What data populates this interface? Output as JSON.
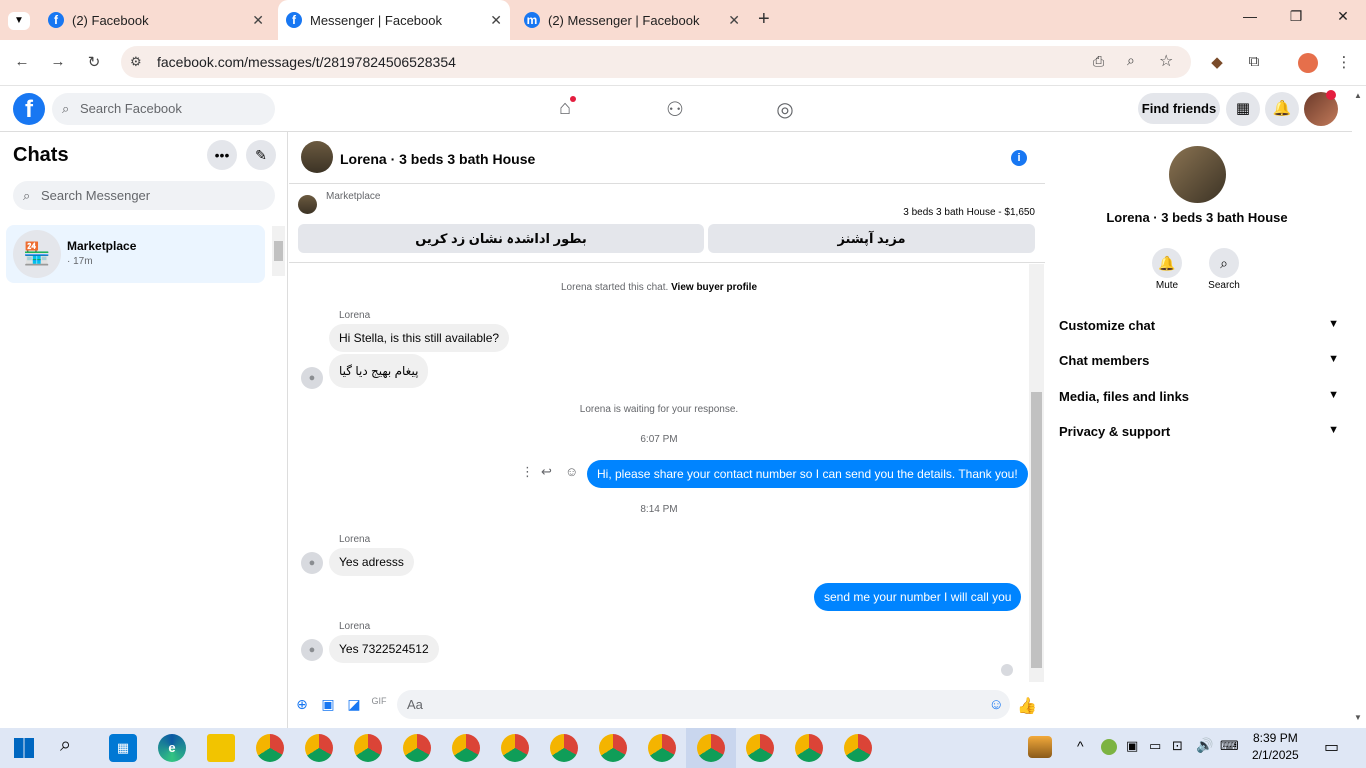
{
  "browser": {
    "tabs": [
      {
        "title": "(2) Facebook",
        "active": false
      },
      {
        "title": "Messenger | Facebook",
        "active": true
      },
      {
        "title": "(2) Messenger | Facebook",
        "active": false
      }
    ],
    "url": "facebook.com/messages/t/28197824506528354"
  },
  "fb_header": {
    "search_placeholder": "Search Facebook",
    "find_friends": "Find friends"
  },
  "chats": {
    "title": "Chats",
    "search_placeholder": "Search Messenger",
    "items": [
      {
        "name": "Marketplace",
        "time": "· 17m"
      }
    ]
  },
  "conversation": {
    "title": "Lorena · 3 beds 3 bath House",
    "marketplace_label": "Marketplace",
    "listing": "3 beds 3 bath House - $1,650",
    "btn_more_options": "مزید آپشنز",
    "btn_mark_unread": "بطور اداشدہ نشان زد کریں",
    "started_text": "Lorena started this chat.",
    "view_buyer_profile": "View buyer profile",
    "waiting_text": "Lorena is waiting for your response.",
    "messages": [
      {
        "sender": "Lorena",
        "text": "Hi Stella, is this still available?"
      },
      {
        "text": "پیغام بھیج دیا گیا"
      },
      {
        "time": "6:07 PM"
      },
      {
        "out": "Hi, please share your contact number so I can send you the details. Thank you!"
      },
      {
        "time": "8:14 PM"
      },
      {
        "sender": "Lorena",
        "text": "Yes adresss"
      },
      {
        "out": "send me your number I will call you"
      },
      {
        "sender": "Lorena",
        "text": "Yes 7322524512"
      }
    ],
    "composer_placeholder": "Aa"
  },
  "details": {
    "title": "Lorena · 3 beds 3 bath House",
    "mute": "Mute",
    "search": "Search",
    "sections": [
      "Customize chat",
      "Chat members",
      "Media, files and links",
      "Privacy & support"
    ]
  },
  "taskbar": {
    "time": "8:39 PM",
    "date": "2/1/2025"
  }
}
